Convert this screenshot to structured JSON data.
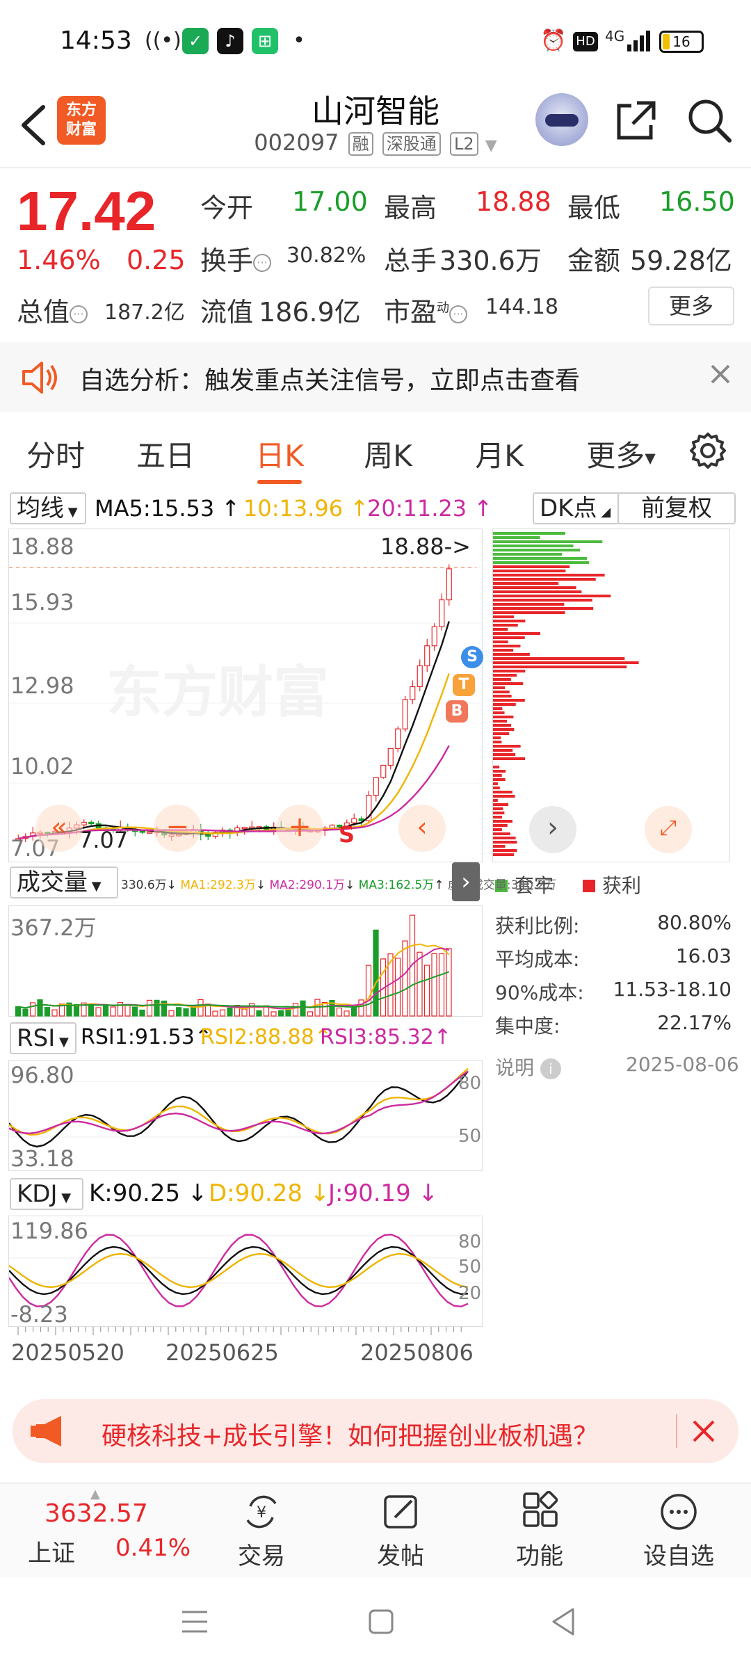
{
  "status_bar": {
    "time": "14:53",
    "battery": "16",
    "network": "4G",
    "hd": "HD"
  },
  "header": {
    "logo": "东方财富",
    "stock_name": "山河智能",
    "stock_code": "002097",
    "tags": [
      "融",
      "深股通",
      "L2"
    ]
  },
  "quote": {
    "price": "17.42",
    "change_pct": "1.46%",
    "change_amt": "0.25",
    "open_label": "今开",
    "open": "17.00",
    "high_label": "最高",
    "high": "18.88",
    "low_label": "最低",
    "low": "16.50",
    "turnover_label": "换手",
    "turnover": "30.82%",
    "volume_label": "总手",
    "volume": "330.6万",
    "amount_label": "金额",
    "amount": "59.28亿",
    "total_cap_label": "总值",
    "total_cap": "187.2亿",
    "float_cap_label": "流值",
    "float_cap": "186.9亿",
    "pe_label": "市盈",
    "pe_sup": "动",
    "pe": "144.18",
    "more_label": "更多"
  },
  "alert": {
    "text": "自选分析：触发重点关注信号，立即点击查看"
  },
  "tabs": [
    {
      "label": "分时"
    },
    {
      "label": "五日"
    },
    {
      "label": "日K"
    },
    {
      "label": "周K"
    },
    {
      "label": "月K"
    },
    {
      "label": "更多"
    }
  ],
  "ma_row": {
    "selector": "均线",
    "ma5": "MA5:15.53",
    "ma10": "10:13.96",
    "ma20": "20:11.23",
    "dk_label": "DK点",
    "fq_label": "前复权"
  },
  "kline": {
    "y_labels": [
      "18.88",
      "15.93",
      "12.98",
      "10.02",
      "7.07"
    ],
    "high_marker": "18.88->",
    "low_marker": "7.07",
    "watermark": "东方财富",
    "signals": [
      "S",
      "T",
      "B"
    ],
    "s_marker": "S"
  },
  "volume": {
    "selector": "成交量",
    "info": "330.6万",
    "ma1": "MA1:292.3万",
    "ma2": "MA2:290.1万",
    "ma3": "MA3:162.5万",
    "virtual": "虚拟成交量:340.2万",
    "y_label": "367.2万"
  },
  "rsi": {
    "selector": "RSI",
    "rsi1": "RSI1:91.53",
    "rsi2": "RSI2:88.88",
    "rsi3": "RSI3:85.32",
    "y_top": "96.80",
    "y_bottom": "33.18",
    "lvl_80": "80",
    "lvl_50": "50"
  },
  "kdj": {
    "selector": "KDJ",
    "k": "K:90.25",
    "d": "D:90.28",
    "j": "J:90.19",
    "y_top": "119.86",
    "y_bottom": "-8.23",
    "lvl_80": "80",
    "lvl_50": "50",
    "lvl_20": "20"
  },
  "x_axis": [
    "20250520",
    "20250625",
    "20250806"
  ],
  "chip": {
    "legend_trapped": "套牢",
    "legend_profit": "获利",
    "stats": [
      {
        "label": "获利比例:",
        "value": "80.80%"
      },
      {
        "label": "平均成本:",
        "value": "16.03"
      },
      {
        "label": "90%成本:",
        "value": "11.53-18.10"
      },
      {
        "label": "集中度:",
        "value": "22.17%"
      }
    ],
    "note_label": "说明",
    "date": "2025-08-06"
  },
  "ad": {
    "text": "硬核科技+成长引擎！如何把握创业板机遇？"
  },
  "bottom_bar": {
    "index_value": "3632.57",
    "index_name": "上证",
    "index_pct": "0.41%",
    "items": [
      {
        "label": "交易"
      },
      {
        "label": "发帖"
      },
      {
        "label": "功能"
      },
      {
        "label": "设自选"
      }
    ]
  },
  "colors": {
    "up": "#e8262a",
    "down": "#1a9d2a",
    "accent": "#f15a24",
    "ma5": "#111111",
    "ma10": "#f0b400",
    "ma20": "#cc2aa0"
  }
}
